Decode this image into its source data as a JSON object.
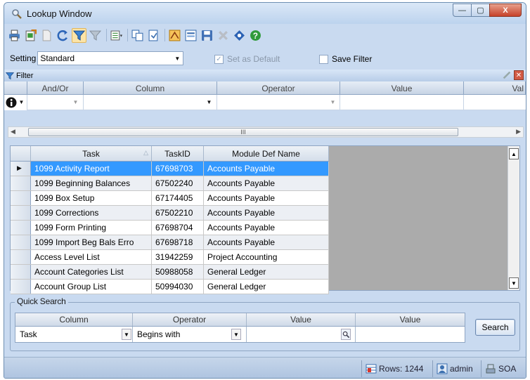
{
  "window": {
    "title": "Lookup Window",
    "controls": {
      "minimize": "—",
      "maximize": "▢",
      "close": "X"
    }
  },
  "toolbar": {
    "icons": [
      "print-icon",
      "export-icon",
      "new-icon",
      "refresh-icon",
      "filter-icon",
      "clear-filter-icon",
      "columns-icon",
      "copy-icon",
      "copy-document-icon",
      "report-icon",
      "layout-icon",
      "save-icon",
      "delete-icon",
      "navigate-icon",
      "help-icon"
    ]
  },
  "setting": {
    "label": "Setting",
    "value": "Standard",
    "set_default_label": "Set as Default",
    "save_filter_label": "Save Filter"
  },
  "filter": {
    "title": "Filter",
    "columns": [
      "And/Or",
      "Column",
      "Operator",
      "Value",
      "Val"
    ]
  },
  "scroll": {
    "grip": "III"
  },
  "grid": {
    "columns": [
      "Task",
      "TaskID",
      "Module Def Name"
    ],
    "rows": [
      {
        "task": "1099 Activity Report",
        "id": "67698703",
        "module": "Accounts Payable"
      },
      {
        "task": "1099 Beginning Balances",
        "id": "67502240",
        "module": "Accounts Payable"
      },
      {
        "task": "1099 Box Setup",
        "id": "67174405",
        "module": "Accounts Payable"
      },
      {
        "task": "1099 Corrections",
        "id": "67502210",
        "module": "Accounts Payable"
      },
      {
        "task": "1099 Form Printing",
        "id": "67698704",
        "module": "Accounts Payable"
      },
      {
        "task": "1099 Import Beg Bals Erro",
        "id": "67698718",
        "module": "Accounts Payable"
      },
      {
        "task": "Access Level List",
        "id": "31942259",
        "module": "Project Accounting"
      },
      {
        "task": "Account Categories List",
        "id": "50988058",
        "module": "General Ledger"
      },
      {
        "task": "Account Group List",
        "id": "50994030",
        "module": "General Ledger"
      }
    ],
    "selected_row": 0
  },
  "quick_search": {
    "title": "Quick Search",
    "columns": [
      "Column",
      "Operator",
      "Value",
      "Value"
    ],
    "column_value": "Task",
    "operator_value": "Begins with",
    "value_1": "",
    "value_2": "",
    "search_button": "Search"
  },
  "status": {
    "rows": "Rows: 1244",
    "user": "admin",
    "system": "SOA"
  },
  "colors": {
    "selection": "#3399ff",
    "frame": "#c9daf0"
  }
}
